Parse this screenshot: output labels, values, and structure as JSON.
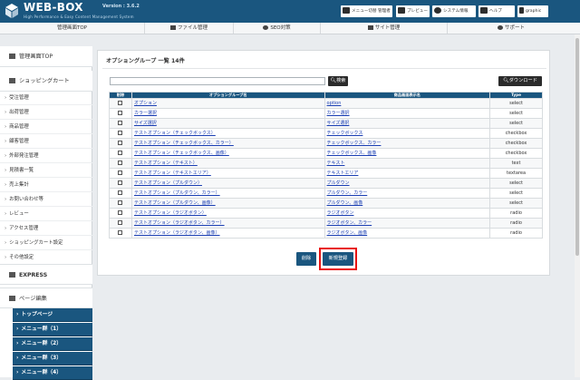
{
  "header": {
    "logo": "WEB-BOX",
    "version": "Version : 3.6.2",
    "subtitle": "High Performance & Easy Content Management System",
    "buttons": [
      {
        "label": "メニュー切替 管理者",
        "icon": "menu-switch-icon"
      },
      {
        "label": "プレビュー",
        "icon": "monitor-icon"
      },
      {
        "label": "システム情報",
        "icon": "gear-icon"
      },
      {
        "label": "ヘルプ",
        "icon": "book-icon"
      },
      {
        "label": "graphic",
        "icon": "user-icon"
      }
    ]
  },
  "gnav": [
    "管理画面TOP",
    "ファイル管理",
    "SEO対策",
    "サイト管理",
    "サポート"
  ],
  "sidebar": {
    "top": "管理画面TOP",
    "shop": "ショッピングカート",
    "items": [
      "受注管理",
      "出荷管理",
      "商品管理",
      "顧客管理",
      "外部発注管理",
      "見積書一覧",
      "売上集計",
      "お問い合わせ等",
      "レビュー",
      "アクセス管理",
      "ショッピングカート設定",
      "その他設定"
    ],
    "express": "EXPRESS",
    "page": "ページ編集",
    "blue": [
      "トップページ",
      "メニュー群（1）",
      "メニュー群（2）",
      "メニュー群（3）",
      "メニュー群（4）"
    ]
  },
  "main": {
    "title": "オプショングループ 一覧 14件",
    "search_value": "",
    "search_btn": "検索",
    "download_btn": "ダウンロード",
    "columns": [
      "削除",
      "オプショングループ名",
      "商品画面表示名",
      "Type"
    ],
    "rows": [
      [
        "オプション",
        "option",
        "select"
      ],
      [
        "カラー選択",
        "カラー選択",
        "select"
      ],
      [
        "サイズ選択",
        "サイズ選択",
        "select"
      ],
      [
        "テストオプション（チェックボックス）",
        "チェックボックス",
        "checkbox"
      ],
      [
        "テストオプション（チェックボックス、カラー）",
        "チェックボックス、カラー",
        "checkbox"
      ],
      [
        "テストオプション（チェックボックス、画像）",
        "チェックボックス、画像",
        "checkbox"
      ],
      [
        "テストオプション（テキスト）",
        "テキスト",
        "text"
      ],
      [
        "テストオプション（テキストエリア）",
        "テキストエリア",
        "textarea"
      ],
      [
        "テストオプション（プルダウン）",
        "プルダウン",
        "select"
      ],
      [
        "テストオプション（プルダウン、カラー）",
        "プルダウン、カラー",
        "select"
      ],
      [
        "テストオプション（プルダウン、画像）",
        "プルダウン、画像",
        "select"
      ],
      [
        "テストオプション（ラジオボタン）",
        "ラジオボタン",
        "radio"
      ],
      [
        "テストオプション（ラジオボタン、カラー）",
        "ラジオボタン、カラー",
        "radio"
      ],
      [
        "テストオプション（ラジオボタン、画像）",
        "ラジオボタン、画像",
        "radio"
      ]
    ],
    "delete_btn": "削除",
    "new_btn": "新規登録"
  },
  "colors": {
    "brand": "#1a567f",
    "highlight": "#e81313"
  }
}
